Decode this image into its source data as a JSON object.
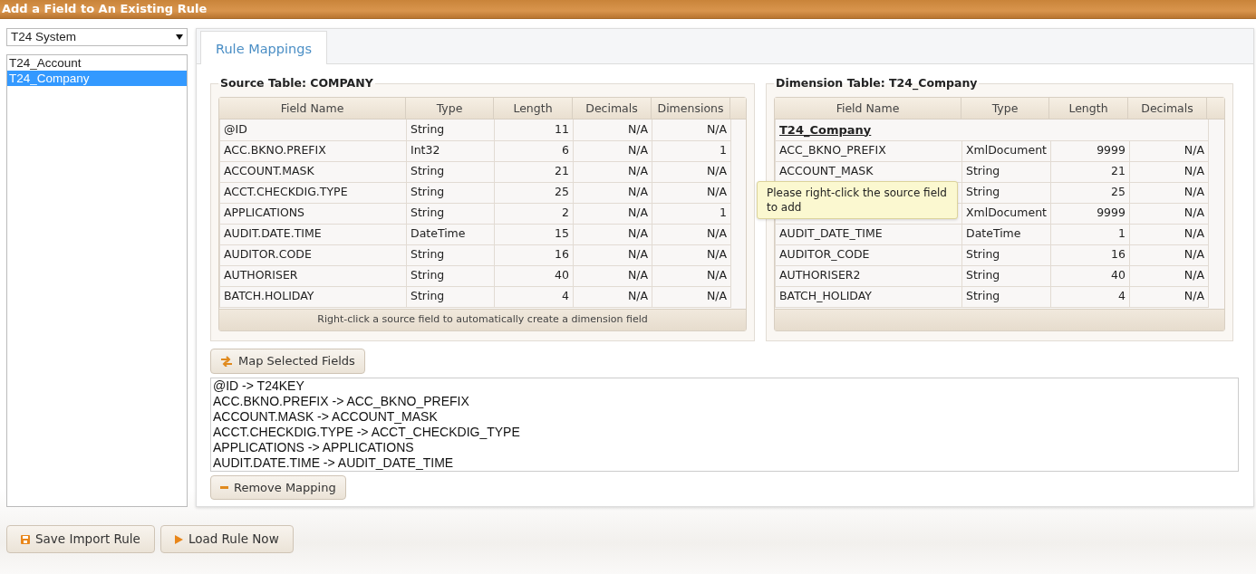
{
  "title": "Add a Field to An Existing Rule",
  "system_select": {
    "value": "T24 System"
  },
  "rules": [
    {
      "label": "T24_Account",
      "selected": false
    },
    {
      "label": "T24_Company",
      "selected": true
    }
  ],
  "tabs": [
    {
      "label": "Rule Mappings",
      "selected": true
    }
  ],
  "source_table": {
    "legend": "Source Table: COMPANY",
    "columns": [
      "Field Name",
      "Type",
      "Length",
      "Decimals",
      "Dimensions"
    ],
    "rows": [
      [
        "@ID",
        "String",
        "11",
        "N/A",
        "N/A"
      ],
      [
        "ACC.BKNO.PREFIX",
        "Int32",
        "6",
        "N/A",
        "1"
      ],
      [
        "ACCOUNT.MASK",
        "String",
        "21",
        "N/A",
        "N/A"
      ],
      [
        "ACCT.CHECKDIG.TYPE",
        "String",
        "25",
        "N/A",
        "N/A"
      ],
      [
        "APPLICATIONS",
        "String",
        "2",
        "N/A",
        "1"
      ],
      [
        "AUDIT.DATE.TIME",
        "DateTime",
        "15",
        "N/A",
        "N/A"
      ],
      [
        "AUDITOR.CODE",
        "String",
        "16",
        "N/A",
        "N/A"
      ],
      [
        "AUTHORISER",
        "String",
        "40",
        "N/A",
        "N/A"
      ],
      [
        "BATCH.HOLIDAY",
        "String",
        "4",
        "N/A",
        "N/A"
      ]
    ],
    "footer": "Right-click a source field to automatically create a dimension field"
  },
  "dimension_table": {
    "legend": "Dimension Table: T24_Company",
    "columns": [
      "Field Name",
      "Type",
      "Length",
      "Decimals"
    ],
    "group": "T24_Company",
    "rows": [
      {
        "field_name": "ACC_BKNO_PREFIX",
        "type": "XmlDocument",
        "length": "9999",
        "decimals": "N/A"
      },
      {
        "field_name": "ACCOUNT_MASK",
        "type": "String",
        "length": "21",
        "decimals": "N/A"
      },
      {
        "type": "String",
        "length": "25",
        "decimals": "N/A"
      },
      {
        "type": "XmlDocument",
        "length": "9999",
        "decimals": "N/A"
      },
      {
        "field_name": "AUDIT_DATE_TIME",
        "type": "DateTime",
        "length": "1",
        "decimals": "N/A"
      },
      {
        "field_name": "AUDITOR_CODE",
        "type": "String",
        "length": "16",
        "decimals": "N/A"
      },
      {
        "field_name": "AUTHORISER2",
        "type": "String",
        "length": "40",
        "decimals": "N/A"
      },
      {
        "field_name": "BATCH_HOLIDAY",
        "type": "String",
        "length": "4",
        "decimals": "N/A"
      }
    ]
  },
  "tooltip": "Please right-click the source field to add",
  "map_button": "Map Selected Fields",
  "mappings": [
    "@ID -> T24KEY",
    "ACC.BKNO.PREFIX -> ACC_BKNO_PREFIX",
    "ACCOUNT.MASK -> ACCOUNT_MASK",
    "ACCT.CHECKDIG.TYPE -> ACCT_CHECKDIG_TYPE",
    "APPLICATIONS -> APPLICATIONS",
    "AUDIT.DATE.TIME -> AUDIT_DATE_TIME"
  ],
  "remove_button": "Remove Mapping",
  "footer_buttons": [
    {
      "kind": "save",
      "label": "Save Import Rule"
    },
    {
      "kind": "run",
      "label": "Load Rule Now"
    }
  ]
}
